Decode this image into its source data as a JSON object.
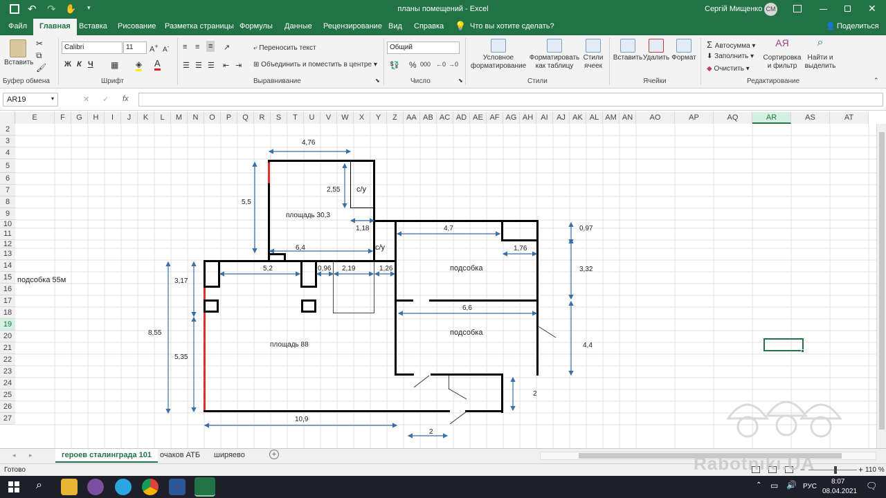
{
  "window": {
    "title": "планы помещений  -  Excel",
    "user": "Сергій Мищенко",
    "initials": "СМ"
  },
  "ribbon_tabs": [
    "Файл",
    "Главная",
    "Вставка",
    "Рисование",
    "Разметка страницы",
    "Формулы",
    "Данные",
    "Рецензирование",
    "Вид",
    "Справка"
  ],
  "tell_me": "Что вы хотите сделать?",
  "share": "Поделиться",
  "ribbon": {
    "paste": "Вставить",
    "clipboard": "Буфер обмена",
    "font_name": "Calibri",
    "font_size": "11",
    "font_group": "Шрифт",
    "bold": "Ж",
    "italic": "К",
    "underline": "Ч",
    "wrap": "Переносить текст",
    "merge": "Объединить и поместить в центре",
    "align_group": "Выравнивание",
    "number_format": "Общий",
    "number_group": "Число",
    "cond_format": [
      "Условное",
      "форматирование"
    ],
    "format_table": [
      "Форматировать",
      "как таблицу"
    ],
    "cell_styles": [
      "Стили",
      "ячеек"
    ],
    "styles_group": "Стили",
    "insert": "Вставить",
    "delete": "Удалить",
    "format": "Формат",
    "cells_group": "Ячейки",
    "autosum": "Автосумма",
    "fill": "Заполнить",
    "clear": "Очистить",
    "sort": [
      "Сортировка",
      "и фильтр"
    ],
    "find": [
      "Найти и",
      "выделить"
    ],
    "edit_group": "Редактирование"
  },
  "name_box": "AR19",
  "fx": "fx",
  "columns": [
    "E",
    "F",
    "G",
    "H",
    "I",
    "J",
    "K",
    "L",
    "M",
    "N",
    "O",
    "P",
    "Q",
    "R",
    "S",
    "T",
    "U",
    "V",
    "W",
    "X",
    "Y",
    "Z",
    "AA",
    "AB",
    "AC",
    "AD",
    "AE",
    "AF",
    "AG",
    "AH",
    "AI",
    "AJ",
    "AK",
    "AL",
    "AM",
    "AN",
    "AO",
    "AP",
    "AQ",
    "AR",
    "AS",
    "AT"
  ],
  "rows": [
    "2",
    "3",
    "4",
    "5",
    "6",
    "7",
    "8",
    "9",
    "10",
    "11",
    "12",
    "13",
    "14",
    "15",
    "16",
    "17",
    "18",
    "19",
    "20",
    "21",
    "22",
    "23",
    "24",
    "25",
    "26",
    "27"
  ],
  "cell_note": "подсобка 55м",
  "plan": {
    "labels": {
      "d476": "4,76",
      "d255": "2,55",
      "su1": "с/у",
      "d55": "5,5",
      "area303": "площадь 30,3",
      "d118": "1,18",
      "d47": "4,7",
      "d097": "0,97",
      "d64": "6,4",
      "su2": "с/у",
      "d176": "1,76",
      "d52": "5,2",
      "d096": "0,96",
      "d219": "2,19",
      "d126": "1,26",
      "podsobka1": "подсобка",
      "d332": "3,32",
      "d317": "3,17",
      "d66": "6,6",
      "podsobka2": "подсобка",
      "d855": "8,55",
      "area88": "площадь 88",
      "d535": "5,35",
      "d44": "4,4",
      "d2a": "2",
      "d109": "10,9",
      "d2b": "2"
    }
  },
  "sheets": [
    "героев сталинграда 101",
    "очаков АТБ",
    "ширяево"
  ],
  "status": "Готово",
  "zoom": "110 %",
  "watermark": "Rabotniki.UA",
  "taskbar": {
    "lang": "РУС",
    "time": "8:07",
    "date": "08.04.2021"
  },
  "colors": {
    "excel_green": "#217346",
    "red_wall": "#e03030"
  }
}
